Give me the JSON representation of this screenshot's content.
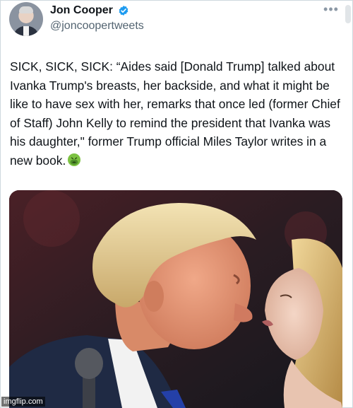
{
  "post": {
    "author": {
      "display_name": "Jon Cooper",
      "handle": "@joncoopertweets",
      "verified": true
    },
    "more_menu_label": "•••",
    "text": "SICK, SICK, SICK: “Aides said [Donald Trump] talked about Ivanka Trump's breasts, her backside, and what it might be like to have sex with her, remarks that once led (former Chief of Staff) John Kelly to remind the president that Ivanka was his daughter,\" former Trump official Miles Taylor writes in a new book.",
    "text_emoji": "nauseated-face-emoji"
  },
  "media": {
    "type": "photo"
  },
  "watermark": "imgflip.com",
  "colors": {
    "text": "#0f1419",
    "secondary_text": "#536471",
    "verified_blue": "#1d9bf0",
    "border": "#cfd9de"
  }
}
